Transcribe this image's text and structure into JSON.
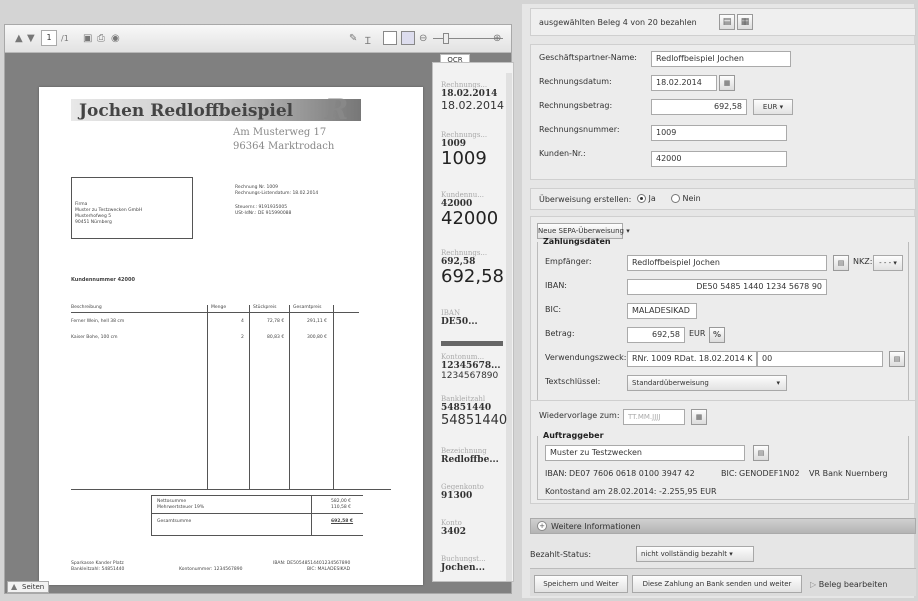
{
  "viewer": {
    "page_current": "1",
    "page_total": "/1",
    "pages_tab": "Seiten"
  },
  "document": {
    "company": "Jochen Redloffbeispiel",
    "logo_letter": "R",
    "address_line1": "Am Musterweg 17",
    "address_line2": "96364 Marktrodach",
    "recipient": [
      "Firma",
      "Muster zu Testzwecken GmbH",
      "Musterhofweg 5",
      "90451 Nürnberg"
    ],
    "meta": [
      "Rechnung Nr. 1009",
      "Rechnungs-Listendatum: 18.02.2014",
      "",
      "Steuernr.: 9191935005",
      "USt-IdNr.: DE 915990088"
    ],
    "customer_no": "Kundennummer 42000",
    "table_headers": [
      "Beschreibung",
      "Menge",
      "Stückpreis",
      "Gesamtpreis"
    ],
    "rows": [
      [
        "Ferner Wein, hell 38 cm",
        "4",
        "72,78 €",
        "291,11 €"
      ],
      [
        "Kaiser Bohe, 100 cm",
        "2",
        "80,83 €",
        "300,80 €"
      ]
    ],
    "totals": [
      [
        "Nettosumme",
        "582,00 €"
      ],
      [
        "Mehrwertsteuer 19%",
        "110,58 €"
      ],
      [
        "Gesamtsumme",
        "692,58 €"
      ]
    ],
    "footer_left": [
      "Sparkasse Kander Platz",
      "Bankleitzahl: 54851440"
    ],
    "footer_mid": "Kontonummer: 1234567890",
    "footer_right": [
      "IBAN: DE50548514401234567890",
      "BIC: MALADESIKAD"
    ]
  },
  "ocr": {
    "tab": "OCR",
    "items": [
      {
        "label": "Rechnungs...",
        "value": "18.02.2014",
        "big": "18.02.2014",
        "size": "sm"
      },
      {
        "label": "Rechnungs...",
        "value": "1009",
        "big": "1009",
        "size": "big"
      },
      {
        "label": "Kundennu...",
        "value": "42000",
        "big": "42000",
        "size": "big"
      },
      {
        "label": "Rechnungs...",
        "value": "692,58",
        "big": "692,58",
        "size": "big"
      },
      {
        "label": "IBAN",
        "value": "DE50...",
        "big": "",
        "size": "sm"
      },
      {
        "label": "Kontonum...",
        "value": "12345678...",
        "big": "1234567890",
        "size": "sm"
      },
      {
        "label": "Bankleitzahl",
        "value": "54851440",
        "big": "54851440",
        "size": "big"
      },
      {
        "label": "Bezeichnung",
        "value": "Redloffbe...",
        "big": "",
        "size": "sm"
      },
      {
        "label": "Gegenkonto",
        "value": "91300",
        "big": "",
        "size": "sm"
      },
      {
        "label": "Konto",
        "value": "3402",
        "big": "",
        "size": "sm"
      },
      {
        "label": "Buchungst...",
        "value": "Jochen...",
        "big": "",
        "size": "sm"
      }
    ]
  },
  "form": {
    "pay_text": "ausgewählten Beleg 4 von 20 bezahlen",
    "partner_label": "Geschäftspartner-Name:",
    "partner_value": "Redloffbeispiel Jochen",
    "date_label": "Rechnungsdatum:",
    "date_value": "18.02.2014",
    "amount_label": "Rechnungsbetrag:",
    "amount_value": "692,58",
    "currency": "EUR",
    "number_label": "Rechnungsnummer:",
    "number_value": "1009",
    "customer_label": "Kunden-Nr.:",
    "customer_value": "42000",
    "transfer_label": "Überweisung erstellen:",
    "yes": "Ja",
    "no": "Nein",
    "sepa_button": "Neue SEPA-Überweisung",
    "payment_header": "Zahlungsdaten",
    "recipient_label": "Empfänger:",
    "recipient_value": "Redloffbeispiel Jochen",
    "nkz_label": "NKZ:",
    "nkz_value": "- - -",
    "iban_label": "IBAN:",
    "iban_value": "DE50 5485 1440 1234 5678 90",
    "bic_label": "BIC:",
    "bic_value": "MALADESIKAD",
    "betrag_label": "Betrag:",
    "betrag_value": "692,58",
    "betrag_currency": "EUR",
    "purpose_label": "Verwendungszweck:",
    "purpose_value1": "RNr. 1009 RDat. 18.02.2014 K",
    "purpose_value2": "00",
    "textkey_label": "Textschlüssel:",
    "textkey_value": "Standardüberweisung",
    "resubmit_label": "Wiedervorlage zum:",
    "resubmit_placeholder": "TT.MM.JJJJ",
    "auftraggeber_header": "Auftraggeber",
    "auftraggeber_value": "Muster zu Testzwecken",
    "auftraggeber_iban_label": "IBAN:",
    "auftraggeber_iban": "DE07 7606 0618 0100 3947 42",
    "auftraggeber_bic_label": "BIC:",
    "auftraggeber_bic": "GENODEF1N02",
    "auftraggeber_bank": "VR Bank Nuernberg",
    "balance_text": "Kontostand am 28.02.2014: -2.255,95 EUR",
    "more_info": "Weitere Informationen",
    "status_label": "Bezahlt-Status:",
    "status_value": "nicht vollständig bezahlt",
    "save_button": "Speichern und Weiter",
    "send_button": "Diese Zahlung an Bank senden und weiter",
    "edit_link": "Beleg bearbeiten"
  }
}
